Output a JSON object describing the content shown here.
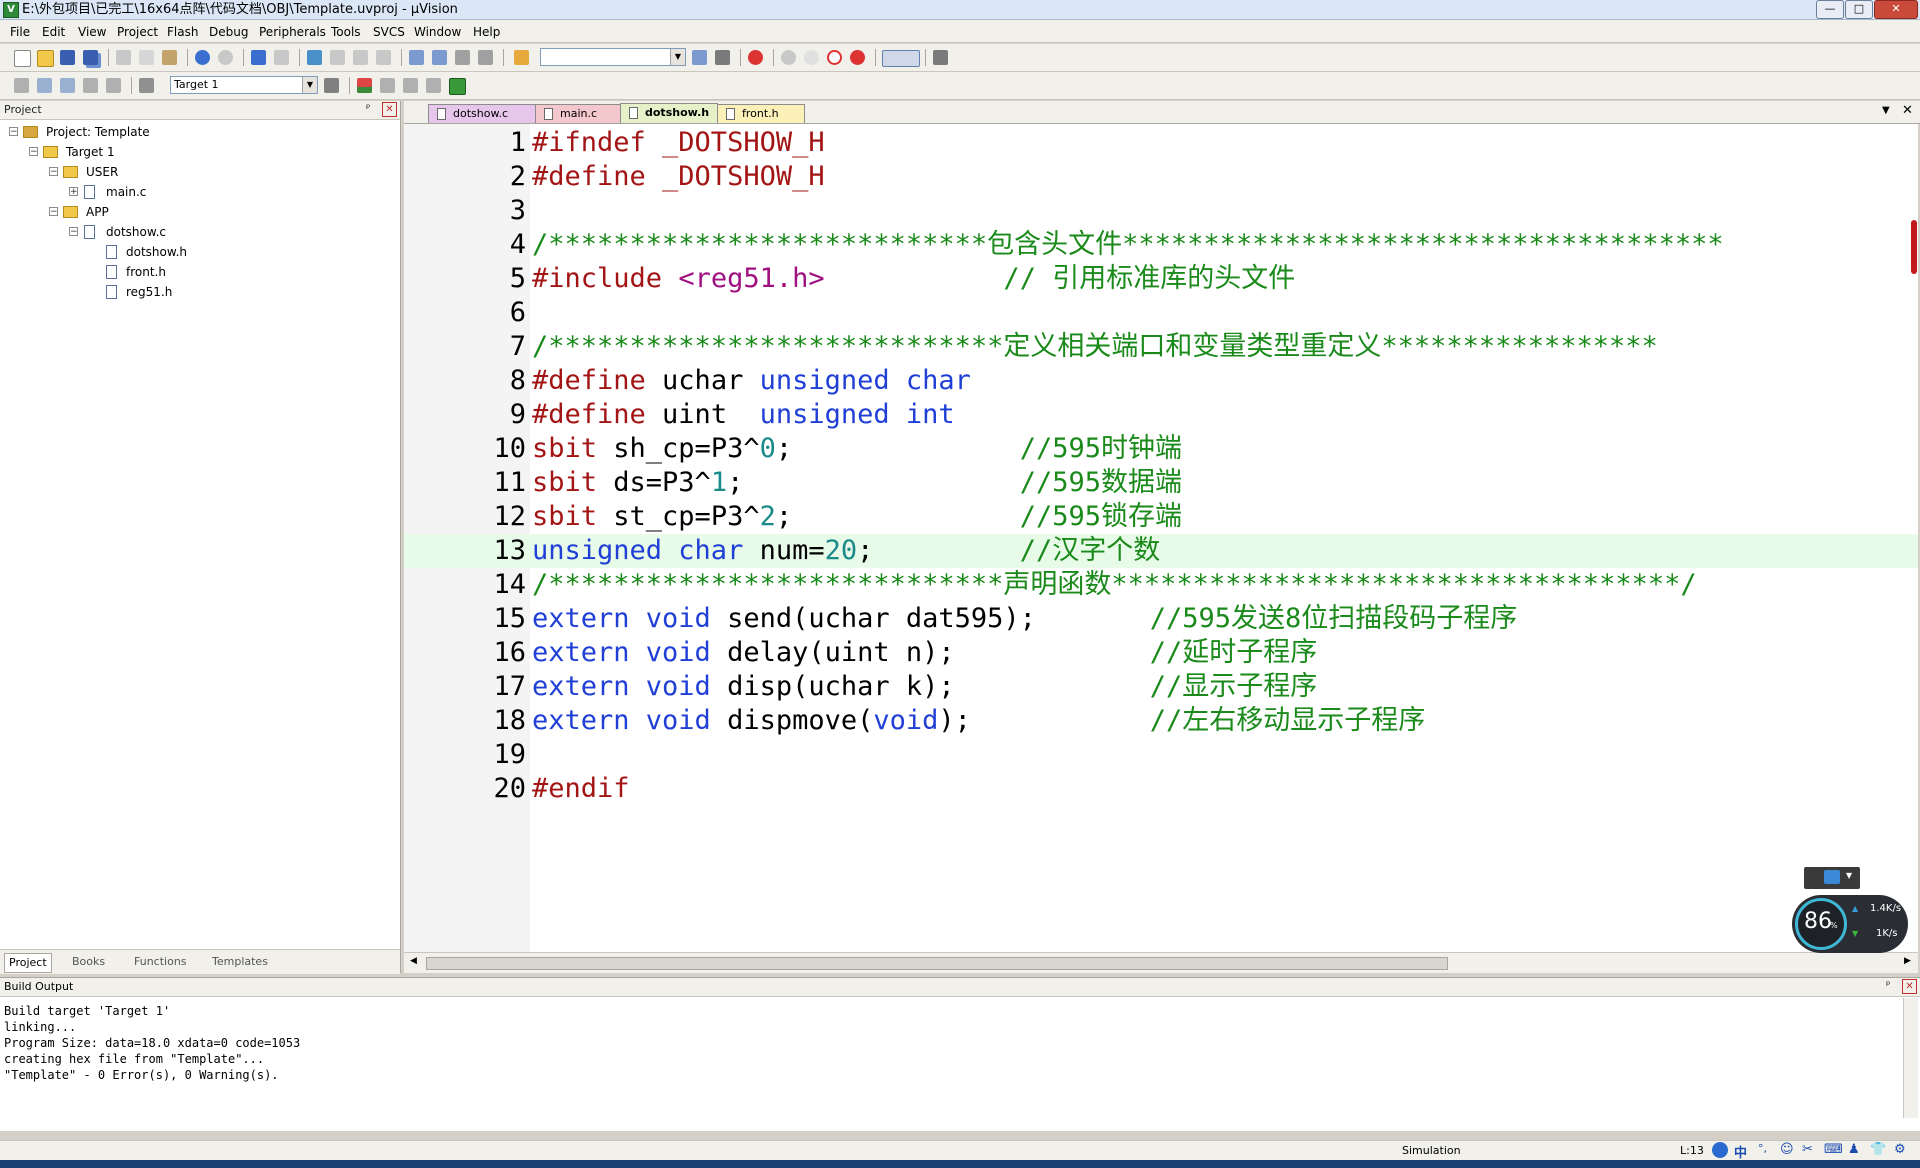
{
  "window": {
    "title": "E:\\外包项目\\已完工\\16x64点阵\\代码文档\\OBJ\\Template.uvproj - µVision",
    "icon_letter": "V",
    "minimize": "—",
    "maximize": "□",
    "close": "✕"
  },
  "menu": [
    "File",
    "Edit",
    "View",
    "Project",
    "Flash",
    "Debug",
    "Peripherals",
    "Tools",
    "SVCS",
    "Window",
    "Help"
  ],
  "toolbar": {
    "find_combo_value": "",
    "target_combo_value": "Target 1"
  },
  "project_panel": {
    "title": "Project",
    "pin": "ᵖ",
    "close": "✕",
    "tree": [
      {
        "label": "Project: Template",
        "level": 0,
        "type": "project",
        "expanded": true
      },
      {
        "label": "Target 1",
        "level": 1,
        "type": "target",
        "expanded": true
      },
      {
        "label": "USER",
        "level": 2,
        "type": "folder",
        "expanded": true
      },
      {
        "label": "main.c",
        "level": 3,
        "type": "file",
        "expandable": true
      },
      {
        "label": "APP",
        "level": 2,
        "type": "folder",
        "expanded": true
      },
      {
        "label": "dotshow.c",
        "level": 3,
        "type": "file",
        "expandable": true,
        "expanded": true
      },
      {
        "label": "dotshow.h",
        "level": 4,
        "type": "file"
      },
      {
        "label": "front.h",
        "level": 4,
        "type": "file"
      },
      {
        "label": "reg51.h",
        "level": 4,
        "type": "file"
      }
    ],
    "tabs": [
      "Project",
      "Books",
      "Functions",
      "Templates"
    ]
  },
  "editor": {
    "tabs": [
      {
        "label": "dotshow.c",
        "color": "#e7c6ec",
        "active": false
      },
      {
        "label": "main.c",
        "color": "#f3c8cc",
        "active": false
      },
      {
        "label": "dotshow.h",
        "color": "#e6f0c9",
        "active": true
      },
      {
        "label": "front.h",
        "color": "#fbf0b8",
        "active": false
      }
    ],
    "highlighted_line": 13,
    "lines": [
      {
        "n": "1",
        "segs": [
          {
            "t": "#ifndef _DOTSHOW_H",
            "c": "#a31515"
          }
        ]
      },
      {
        "n": "2",
        "segs": [
          {
            "t": "#define _DOTSHOW_H",
            "c": "#a31515"
          }
        ]
      },
      {
        "n": "3",
        "segs": []
      },
      {
        "n": "4",
        "segs": [
          {
            "t": "/***************************包含头文件*************************************",
            "c": "#1a8a1a"
          }
        ]
      },
      {
        "n": "5",
        "segs": [
          {
            "t": "#include ",
            "c": "#a31515"
          },
          {
            "t": "<reg51.h>",
            "c": "#a01080"
          },
          {
            "t": "           // 引用标准库的头文件",
            "c": "#1a8a1a"
          }
        ]
      },
      {
        "n": "6",
        "segs": []
      },
      {
        "n": "7",
        "segs": [
          {
            "t": "/****************************定义相关端口和变量类型重定义*****************",
            "c": "#1a8a1a"
          }
        ]
      },
      {
        "n": "8",
        "segs": [
          {
            "t": "#define ",
            "c": "#a31515"
          },
          {
            "t": "uchar ",
            "c": "#000000"
          },
          {
            "t": "unsigned char",
            "c": "#1f3fd6"
          }
        ]
      },
      {
        "n": "9",
        "segs": [
          {
            "t": "#define ",
            "c": "#a31515"
          },
          {
            "t": "uint  ",
            "c": "#000000"
          },
          {
            "t": "unsigned int",
            "c": "#1f3fd6"
          }
        ]
      },
      {
        "n": "10",
        "segs": [
          {
            "t": "sbit ",
            "c": "#a31515"
          },
          {
            "t": "sh_cp=P3^",
            "c": "#000000"
          },
          {
            "t": "0",
            "c": "#1a8a8a"
          },
          {
            "t": ";",
            "c": "#000000"
          },
          {
            "t": "              //595时钟端",
            "c": "#1a8a1a"
          }
        ]
      },
      {
        "n": "11",
        "segs": [
          {
            "t": "sbit ",
            "c": "#a31515"
          },
          {
            "t": "ds=P3^",
            "c": "#000000"
          },
          {
            "t": "1",
            "c": "#1a8a8a"
          },
          {
            "t": ";",
            "c": "#000000"
          },
          {
            "t": "                 //595数据端",
            "c": "#1a8a1a"
          }
        ]
      },
      {
        "n": "12",
        "segs": [
          {
            "t": "sbit ",
            "c": "#a31515"
          },
          {
            "t": "st_cp=P3^",
            "c": "#000000"
          },
          {
            "t": "2",
            "c": "#1a8a8a"
          },
          {
            "t": ";",
            "c": "#000000"
          },
          {
            "t": "              //595锁存端",
            "c": "#1a8a1a"
          }
        ]
      },
      {
        "n": "13",
        "segs": [
          {
            "t": "unsigned char ",
            "c": "#1f3fd6"
          },
          {
            "t": "num=",
            "c": "#000000"
          },
          {
            "t": "20",
            "c": "#1a8a8a"
          },
          {
            "t": ";",
            "c": "#000000"
          },
          {
            "t": "         //汉字个数",
            "c": "#1a8a1a"
          }
        ]
      },
      {
        "n": "14",
        "segs": [
          {
            "t": "/****************************声明函数***********************************/",
            "c": "#1a8a1a"
          }
        ]
      },
      {
        "n": "15",
        "segs": [
          {
            "t": "extern void ",
            "c": "#1f3fd6"
          },
          {
            "t": "send(uchar dat595);",
            "c": "#000000"
          },
          {
            "t": "       //595发送8位扫描段码子程序",
            "c": "#1a8a1a"
          }
        ]
      },
      {
        "n": "16",
        "segs": [
          {
            "t": "extern void ",
            "c": "#1f3fd6"
          },
          {
            "t": "delay(uint n);",
            "c": "#000000"
          },
          {
            "t": "            //延时子程序",
            "c": "#1a8a1a"
          }
        ]
      },
      {
        "n": "17",
        "segs": [
          {
            "t": "extern void ",
            "c": "#1f3fd6"
          },
          {
            "t": "disp(uchar k);",
            "c": "#000000"
          },
          {
            "t": "            //显示子程序",
            "c": "#1a8a1a"
          }
        ]
      },
      {
        "n": "18",
        "segs": [
          {
            "t": "extern void ",
            "c": "#1f3fd6"
          },
          {
            "t": "dispmove(",
            "c": "#000000"
          },
          {
            "t": "void",
            "c": "#1f3fd6"
          },
          {
            "t": ");",
            "c": "#000000"
          },
          {
            "t": "           //左右移动显示子程序",
            "c": "#1a8a1a"
          }
        ]
      },
      {
        "n": "19",
        "segs": []
      },
      {
        "n": "20",
        "segs": [
          {
            "t": "#endif",
            "c": "#a31515"
          }
        ]
      }
    ]
  },
  "build_output": {
    "title": "Build Output",
    "lines": [
      "Build target 'Target 1'",
      "linking...",
      "Program Size: data=18.0 xdata=0 code=1053",
      "creating hex file from \"Template\"...",
      "\"Template\" - 0 Error(s), 0 Warning(s)."
    ]
  },
  "status": {
    "mode": "Simulation",
    "position": "L:13"
  },
  "net_widget": {
    "percent": "86",
    "percent_unit": "%",
    "up": "1.4K/s",
    "down": "1K/s"
  },
  "ime": [
    "中",
    "°,",
    "☺",
    "✂",
    "⌨",
    "♟",
    "👕",
    "⚙"
  ],
  "colors": {
    "accent": "#1f3fd6",
    "comment": "#1a8a1a",
    "preprocessor": "#a31515",
    "number": "#1a8a8a",
    "line_highlight": "#e8fbe8"
  }
}
